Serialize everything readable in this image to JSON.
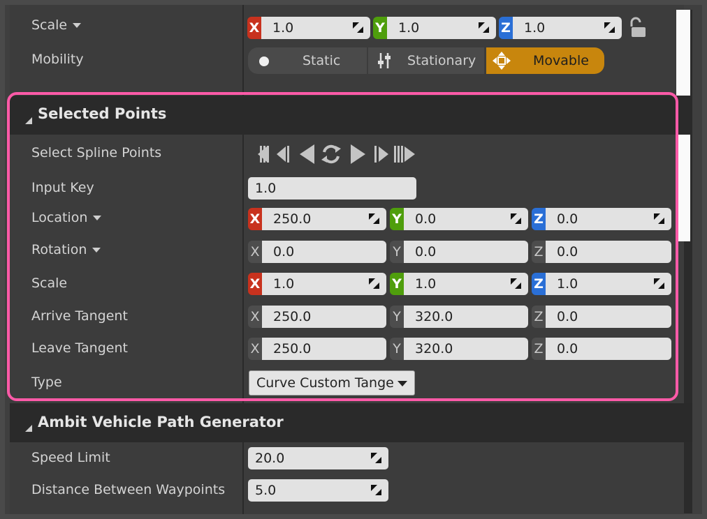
{
  "transform": {
    "scale": {
      "label": "Scale",
      "x": "1.0",
      "y": "1.0",
      "z": "1.0"
    },
    "mobility": {
      "label": "Mobility",
      "options": [
        "Static",
        "Stationary",
        "Movable"
      ],
      "selected": "Movable"
    }
  },
  "selected_points": {
    "title": "Selected Points",
    "select_spline_points_label": "Select Spline Points",
    "input_key": {
      "label": "Input Key",
      "value": "1.0"
    },
    "location": {
      "label": "Location",
      "x": "250.0",
      "y": "0.0",
      "z": "0.0"
    },
    "rotation": {
      "label": "Rotation",
      "x": "0.0",
      "y": "0.0",
      "z": "0.0"
    },
    "scale": {
      "label": "Scale",
      "x": "1.0",
      "y": "1.0",
      "z": "1.0"
    },
    "arrive_tangent": {
      "label": "Arrive Tangent",
      "x": "250.0",
      "y": "320.0",
      "z": "0.0"
    },
    "leave_tangent": {
      "label": "Leave Tangent",
      "x": "250.0",
      "y": "320.0",
      "z": "0.0"
    },
    "type": {
      "label": "Type",
      "value": "Curve Custom Tange"
    }
  },
  "ambit": {
    "title": "Ambit Vehicle Path Generator",
    "speed_limit": {
      "label": "Speed Limit",
      "value": "20.0"
    },
    "distance": {
      "label": "Distance Between Waypoints",
      "value": "5.0"
    }
  },
  "axis_labels": {
    "x": "X",
    "y": "Y",
    "z": "Z"
  },
  "colors": {
    "highlight": "#ff5aa8",
    "movable": "#c8860d",
    "axis_x": "#c8321e",
    "axis_y": "#4f9e0c",
    "axis_z": "#2a6fd6"
  }
}
